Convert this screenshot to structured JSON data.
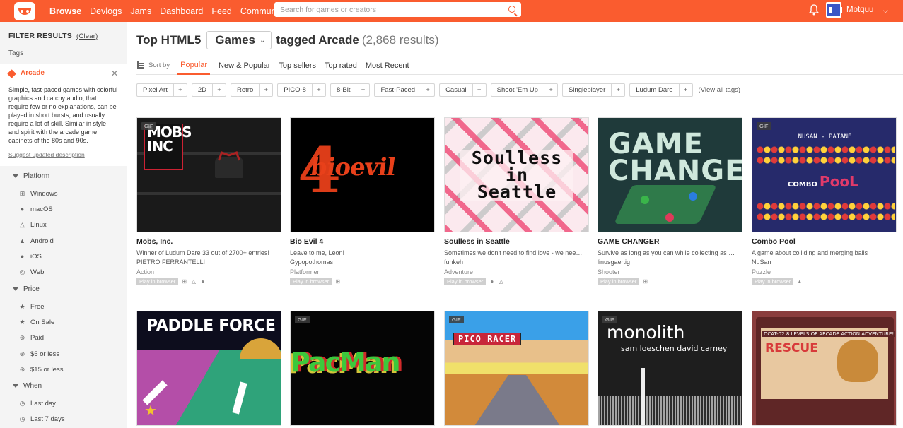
{
  "nav": {
    "items": [
      "Browse",
      "Devlogs",
      "Jams",
      "Dashboard",
      "Feed",
      "Community"
    ],
    "search_placeholder": "Search for games or creators",
    "username": "Motquu"
  },
  "sidebar": {
    "filter_title": "FILTER RESULTS",
    "clear_label": "(Clear)",
    "tags_label": "Tags",
    "active_tag": {
      "name": "Arcade",
      "description": "Simple, fast-paced games with colorful graphics and catchy audio, that require few or no explanations, can be played in short bursts, and usually require a lot of skill. Similar in style and spirit with the arcade game cabinets of the 80s and 90s.",
      "suggest_label": "Suggest updated description"
    },
    "platform": {
      "label": "Platform",
      "options": [
        "Windows",
        "macOS",
        "Linux",
        "Android",
        "iOS",
        "Web"
      ]
    },
    "price": {
      "label": "Price",
      "options": [
        "Free",
        "On Sale",
        "Paid",
        "$5 or less",
        "$15 or less"
      ]
    },
    "when": {
      "label": "When",
      "options": [
        "Last day",
        "Last 7 days"
      ]
    }
  },
  "header": {
    "title_prefix": "Top HTML5",
    "selected_type": "Games",
    "title_suffix": "tagged Arcade",
    "results": "(2,868 results)"
  },
  "sort": {
    "label": "Sort by",
    "tabs": [
      "Popular",
      "New & Popular",
      "Top sellers",
      "Top rated",
      "Most Recent"
    ],
    "active": "Popular"
  },
  "tag_chips": [
    "Pixel Art",
    "2D",
    "Retro",
    "PICO-8",
    "8-Bit",
    "Fast-Paced",
    "Casual",
    "Shoot 'Em Up",
    "Singleplayer",
    "Ludum Dare"
  ],
  "view_all_tags": "(View all tags)",
  "games": [
    {
      "title": "Mobs, Inc.",
      "desc": "Winner of Ludum Dare 33 out of 2700+ entries!",
      "author": "PIETRO FERRANTELLI",
      "genre": "Action",
      "badge": "Play in browser",
      "gif": "GIF",
      "platforms": [
        "windows-icon",
        "linux-icon",
        "apple-icon"
      ]
    },
    {
      "title": "Bio Evil 4",
      "desc": "Leave to me, Leon!",
      "author": "Gypopothomas",
      "genre": "Platformer",
      "badge": "Play in browser",
      "gif": "",
      "platforms": [
        "windows-icon"
      ]
    },
    {
      "title": "Soulless in Seattle",
      "desc": "Sometimes we don't need to find love - we need to find...",
      "author": "funkeh",
      "genre": "Adventure",
      "badge": "Play in browser",
      "gif": "",
      "platforms": [
        "apple-icon",
        "linux-icon"
      ]
    },
    {
      "title": "GAME CHANGER",
      "desc": "Survive as long as you can while collecting as many coins",
      "author": "linusgaertig",
      "genre": "Shooter",
      "badge": "Play in browser",
      "gif": "",
      "platforms": [
        "windows-icon"
      ]
    },
    {
      "title": "Combo Pool",
      "desc": "A game about colliding and merging balls",
      "author": "NuSan",
      "genre": "Puzzle",
      "badge": "Play in browser",
      "gif": "GIF",
      "platforms": [
        "android-icon"
      ]
    },
    {
      "gif": ""
    },
    {
      "gif": "GIF"
    },
    {
      "gif": "GIF"
    },
    {
      "gif": "GIF"
    },
    {
      "gif": ""
    }
  ],
  "thumb_text": {
    "mobs_logo": "MOBS",
    "mobs_logo2": "INC",
    "bio_four": "4",
    "bio_word": "bioevil",
    "soulless": "Soulless in Seattle",
    "gamechanger": "GAME CHANGER",
    "combo_header": "NUSAN - PATANE",
    "combo_small": "COMBO",
    "combo_big": "PooL",
    "paddle": "PADDLE FORCE",
    "pacman": "PacMan",
    "pico": "PICO RACER",
    "mono_title": "monolith",
    "mono_credits": "sam loeschen david carney",
    "rescue_top": "DCAT-02  8 LEVELS OF ARCADE ACTION ADVENTURE!",
    "rescue_title": "RESCUE"
  }
}
